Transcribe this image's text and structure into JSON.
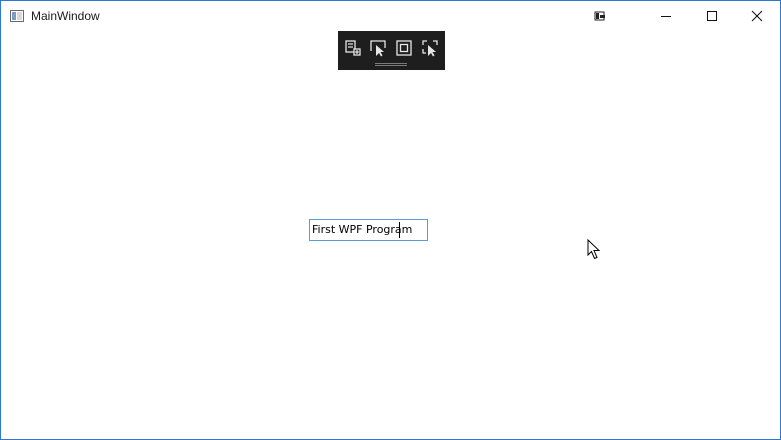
{
  "window": {
    "title": "MainWindow",
    "accent_border": "#2b79d0"
  },
  "titlebar": {
    "buttons": [
      {
        "name": "live-visual-tree",
        "icon": "app-live-icon"
      },
      {
        "name": "minimize",
        "icon": "minimize-icon"
      },
      {
        "name": "maximize",
        "icon": "maximize-icon"
      },
      {
        "name": "close",
        "icon": "close-icon"
      }
    ]
  },
  "runtime_toolbar": {
    "background": "#1e1e1e",
    "tools": [
      {
        "icon": "go-to-live-visual-tree-icon"
      },
      {
        "icon": "select-element-icon"
      },
      {
        "icon": "display-layout-adorners-icon"
      },
      {
        "icon": "track-focused-element-icon"
      }
    ]
  },
  "content": {
    "textbox_value": "First WPF Program",
    "textbox_border": "#5b9bd5"
  }
}
